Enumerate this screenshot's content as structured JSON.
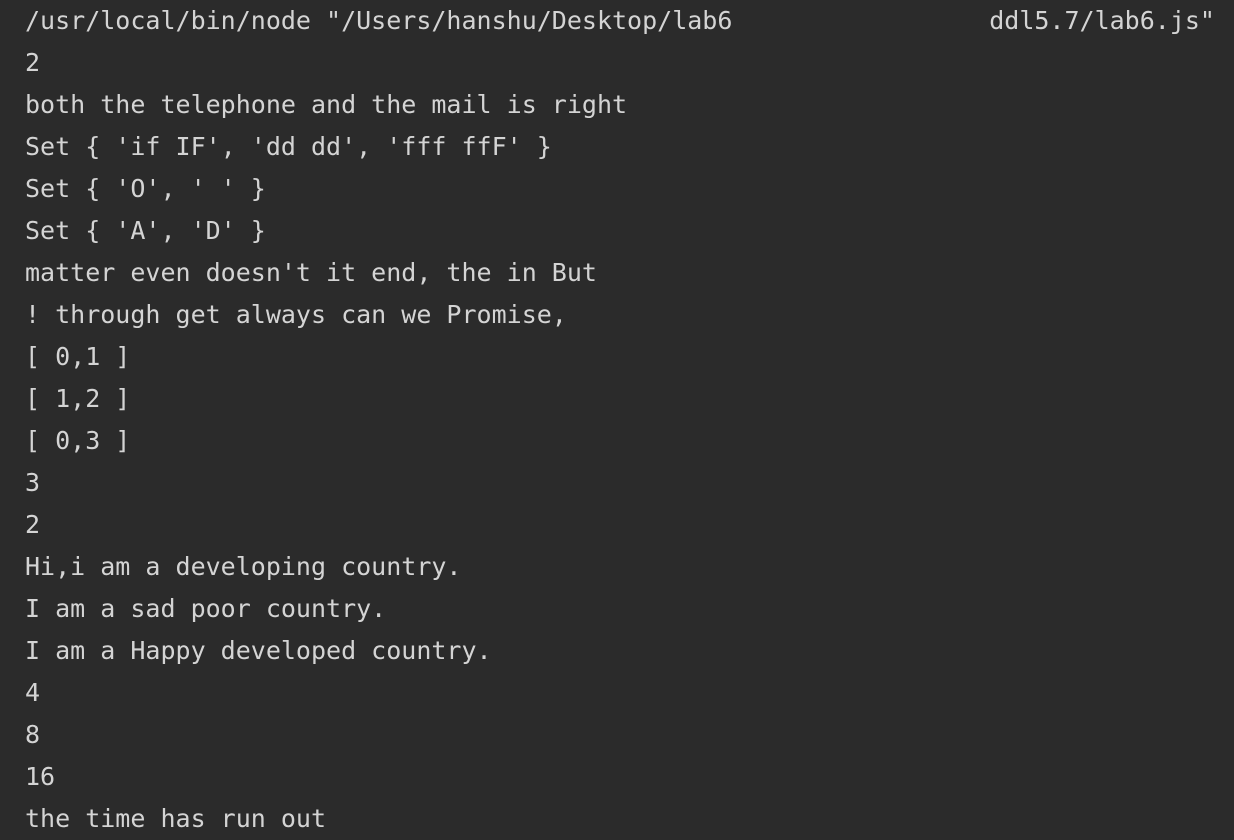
{
  "command": {
    "left": "/usr/local/bin/node \"/Users/hanshu/Desktop/lab6",
    "right": "ddl5.7/lab6.js\""
  },
  "output": [
    "2",
    "both the telephone and the mail is right",
    "Set { 'if IF', 'dd dd', 'fff ffF' }",
    "Set { 'O', ' ' }",
    "Set { 'A', 'D' }",
    "matter even doesn't it end, the in But",
    "! through get always can we Promise,",
    "[ 0,1 ]",
    "[ 1,2 ]",
    "[ 0,3 ]",
    "3",
    "2",
    "Hi,i am a developing country.",
    "I am a sad poor country.",
    "I am a Happy developed country.",
    "4",
    "8",
    "16",
    "the time has run out"
  ]
}
